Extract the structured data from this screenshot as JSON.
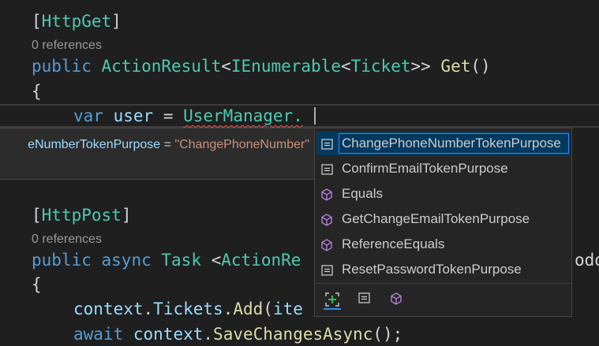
{
  "editor": {
    "lines": {
      "httpget_attr": "HttpGet",
      "refs_get": "0 references",
      "get_public": "public",
      "get_actionresult": "ActionResult",
      "get_ienumerable": "IEnumerable",
      "get_ticket": "Ticket",
      "get_name": "Get",
      "brace1": "{",
      "var_kw": "var",
      "var_user": "user",
      "var_eq": " = ",
      "var_usermanager": "UserManager",
      "var_dot": ".",
      "httppost_attr": "HttpPost",
      "refs_post": "0 references",
      "post_public": "public",
      "post_async": "async",
      "post_task": "Task",
      "post_actionre": "ActionRe",
      "post_tail": "odo",
      "brace2": "{",
      "ctx1_context": "context",
      "ctx1_tickets": "Tickets",
      "ctx1_add": "Add",
      "ctx1_ite": "ite",
      "ctx2_await": "await",
      "ctx2_context": "context",
      "ctx2_save": "SaveChangesAsync",
      "ctx2_tail": "();"
    }
  },
  "quick_info": {
    "name": "eNumberTokenPurpose",
    "equals": " = ",
    "value": "\"ChangePhoneNumber\""
  },
  "completion": {
    "items": [
      {
        "label": "ChangePhoneNumberTokenPurpose",
        "icon": "field-icon",
        "selected": true
      },
      {
        "label": "ConfirmEmailTokenPurpose",
        "icon": "field-icon"
      },
      {
        "label": "Equals",
        "icon": "method-icon"
      },
      {
        "label": "GetChangeEmailTokenPurpose",
        "icon": "method-icon"
      },
      {
        "label": "ReferenceEquals",
        "icon": "method-icon"
      },
      {
        "label": "ResetPasswordTokenPurpose",
        "icon": "field-icon"
      }
    ],
    "filters": [
      "expand-icon",
      "field-filter-icon",
      "method-filter-icon"
    ]
  },
  "colors": {
    "background": "#1f1f1f",
    "keyword": "#569cd6",
    "type": "#4ec9b0",
    "function": "#dcdcaa",
    "identifier": "#9cdcfe",
    "string": "#ce9178",
    "method_icon": "#b180d7",
    "accent": "#2f8fea"
  }
}
